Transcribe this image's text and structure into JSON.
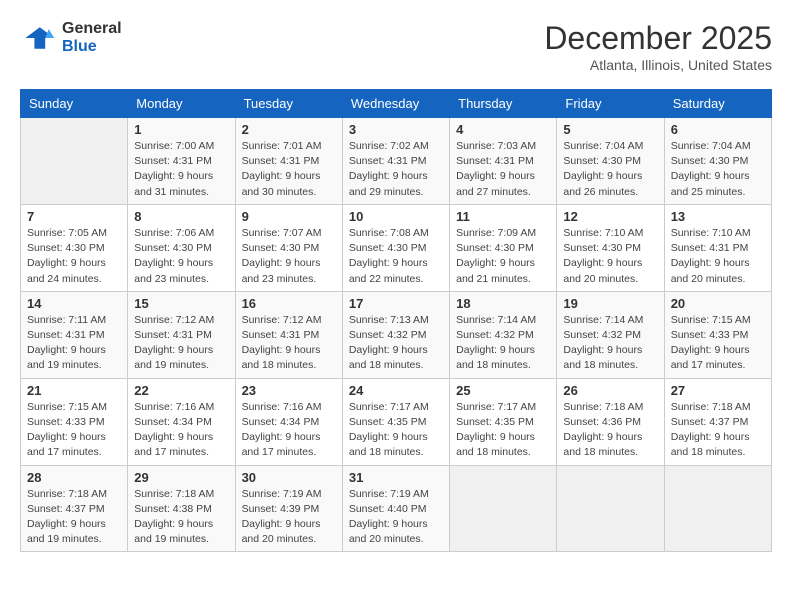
{
  "header": {
    "logo_general": "General",
    "logo_blue": "Blue",
    "month": "December 2025",
    "location": "Atlanta, Illinois, United States"
  },
  "weekdays": [
    "Sunday",
    "Monday",
    "Tuesday",
    "Wednesday",
    "Thursday",
    "Friday",
    "Saturday"
  ],
  "weeks": [
    [
      {
        "day": "",
        "info": ""
      },
      {
        "day": "1",
        "info": "Sunrise: 7:00 AM\nSunset: 4:31 PM\nDaylight: 9 hours\nand 31 minutes."
      },
      {
        "day": "2",
        "info": "Sunrise: 7:01 AM\nSunset: 4:31 PM\nDaylight: 9 hours\nand 30 minutes."
      },
      {
        "day": "3",
        "info": "Sunrise: 7:02 AM\nSunset: 4:31 PM\nDaylight: 9 hours\nand 29 minutes."
      },
      {
        "day": "4",
        "info": "Sunrise: 7:03 AM\nSunset: 4:31 PM\nDaylight: 9 hours\nand 27 minutes."
      },
      {
        "day": "5",
        "info": "Sunrise: 7:04 AM\nSunset: 4:30 PM\nDaylight: 9 hours\nand 26 minutes."
      },
      {
        "day": "6",
        "info": "Sunrise: 7:04 AM\nSunset: 4:30 PM\nDaylight: 9 hours\nand 25 minutes."
      }
    ],
    [
      {
        "day": "7",
        "info": "Sunrise: 7:05 AM\nSunset: 4:30 PM\nDaylight: 9 hours\nand 24 minutes."
      },
      {
        "day": "8",
        "info": "Sunrise: 7:06 AM\nSunset: 4:30 PM\nDaylight: 9 hours\nand 23 minutes."
      },
      {
        "day": "9",
        "info": "Sunrise: 7:07 AM\nSunset: 4:30 PM\nDaylight: 9 hours\nand 23 minutes."
      },
      {
        "day": "10",
        "info": "Sunrise: 7:08 AM\nSunset: 4:30 PM\nDaylight: 9 hours\nand 22 minutes."
      },
      {
        "day": "11",
        "info": "Sunrise: 7:09 AM\nSunset: 4:30 PM\nDaylight: 9 hours\nand 21 minutes."
      },
      {
        "day": "12",
        "info": "Sunrise: 7:10 AM\nSunset: 4:30 PM\nDaylight: 9 hours\nand 20 minutes."
      },
      {
        "day": "13",
        "info": "Sunrise: 7:10 AM\nSunset: 4:31 PM\nDaylight: 9 hours\nand 20 minutes."
      }
    ],
    [
      {
        "day": "14",
        "info": "Sunrise: 7:11 AM\nSunset: 4:31 PM\nDaylight: 9 hours\nand 19 minutes."
      },
      {
        "day": "15",
        "info": "Sunrise: 7:12 AM\nSunset: 4:31 PM\nDaylight: 9 hours\nand 19 minutes."
      },
      {
        "day": "16",
        "info": "Sunrise: 7:12 AM\nSunset: 4:31 PM\nDaylight: 9 hours\nand 18 minutes."
      },
      {
        "day": "17",
        "info": "Sunrise: 7:13 AM\nSunset: 4:32 PM\nDaylight: 9 hours\nand 18 minutes."
      },
      {
        "day": "18",
        "info": "Sunrise: 7:14 AM\nSunset: 4:32 PM\nDaylight: 9 hours\nand 18 minutes."
      },
      {
        "day": "19",
        "info": "Sunrise: 7:14 AM\nSunset: 4:32 PM\nDaylight: 9 hours\nand 18 minutes."
      },
      {
        "day": "20",
        "info": "Sunrise: 7:15 AM\nSunset: 4:33 PM\nDaylight: 9 hours\nand 17 minutes."
      }
    ],
    [
      {
        "day": "21",
        "info": "Sunrise: 7:15 AM\nSunset: 4:33 PM\nDaylight: 9 hours\nand 17 minutes."
      },
      {
        "day": "22",
        "info": "Sunrise: 7:16 AM\nSunset: 4:34 PM\nDaylight: 9 hours\nand 17 minutes."
      },
      {
        "day": "23",
        "info": "Sunrise: 7:16 AM\nSunset: 4:34 PM\nDaylight: 9 hours\nand 17 minutes."
      },
      {
        "day": "24",
        "info": "Sunrise: 7:17 AM\nSunset: 4:35 PM\nDaylight: 9 hours\nand 18 minutes."
      },
      {
        "day": "25",
        "info": "Sunrise: 7:17 AM\nSunset: 4:35 PM\nDaylight: 9 hours\nand 18 minutes."
      },
      {
        "day": "26",
        "info": "Sunrise: 7:18 AM\nSunset: 4:36 PM\nDaylight: 9 hours\nand 18 minutes."
      },
      {
        "day": "27",
        "info": "Sunrise: 7:18 AM\nSunset: 4:37 PM\nDaylight: 9 hours\nand 18 minutes."
      }
    ],
    [
      {
        "day": "28",
        "info": "Sunrise: 7:18 AM\nSunset: 4:37 PM\nDaylight: 9 hours\nand 19 minutes."
      },
      {
        "day": "29",
        "info": "Sunrise: 7:18 AM\nSunset: 4:38 PM\nDaylight: 9 hours\nand 19 minutes."
      },
      {
        "day": "30",
        "info": "Sunrise: 7:19 AM\nSunset: 4:39 PM\nDaylight: 9 hours\nand 20 minutes."
      },
      {
        "day": "31",
        "info": "Sunrise: 7:19 AM\nSunset: 4:40 PM\nDaylight: 9 hours\nand 20 minutes."
      },
      {
        "day": "",
        "info": ""
      },
      {
        "day": "",
        "info": ""
      },
      {
        "day": "",
        "info": ""
      }
    ]
  ]
}
